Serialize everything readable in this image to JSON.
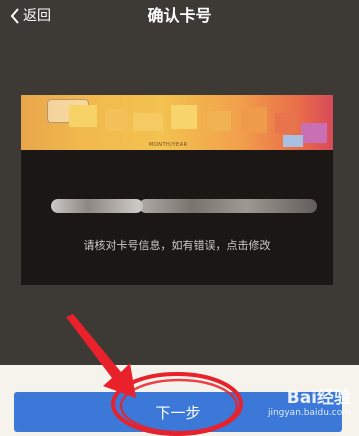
{
  "header": {
    "back_label": "返回",
    "title": "确认卡号"
  },
  "card": {
    "small_text": "MONTH/YEAR",
    "hint": "请核对卡号信息，如有错误，点击修改"
  },
  "footer": {
    "next_label": "下一步"
  },
  "watermark": {
    "logo": "Bai经验",
    "sub": "jingyan.baidu.com"
  },
  "colors": {
    "background": "#3d3a36",
    "button": "#3b78d8",
    "annotation": "#e8212b"
  }
}
